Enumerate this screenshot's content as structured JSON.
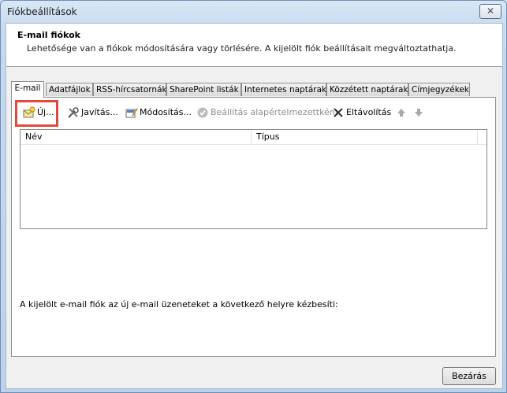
{
  "window": {
    "title": "Fiókbeállítások",
    "close_glyph": "✕"
  },
  "header": {
    "title": "E-mail fiókok",
    "description": "Lehetősége van a fiókok módosítására vagy törlésére. A kijelölt fiók beállításait megváltoztathatja."
  },
  "tabs": [
    {
      "label": "E-mail",
      "active": true
    },
    {
      "label": "Adatfájlok"
    },
    {
      "label": "RSS-hírcsatornák"
    },
    {
      "label": "SharePoint listák"
    },
    {
      "label": "Internetes naptárak"
    },
    {
      "label": "Közzétett naptárak"
    },
    {
      "label": "Címjegyzékek"
    }
  ],
  "toolbar": {
    "new_label": "Új...",
    "repair_label": "Javítás...",
    "change_label": "Módosítás...",
    "set_default_label": "Beállítás alapértelmezettként",
    "remove_label": "Eltávolítás",
    "icons": {
      "new": "new-account-icon",
      "repair": "repair-tools-icon",
      "change": "change-account-icon",
      "set_default": "checkmark-icon",
      "remove": "x-icon",
      "up": "arrow-up-icon",
      "down": "arrow-down-icon"
    }
  },
  "list": {
    "columns": [
      "Név",
      "Típus"
    ],
    "rows": []
  },
  "footnote": "A kijelölt e-mail fiók az új e-mail üzeneteket a következő helyre kézbesíti:",
  "footer": {
    "close_label": "Bezárás"
  },
  "colors": {
    "highlight": "#e2483c",
    "title_bar": "#c6d9ee"
  }
}
